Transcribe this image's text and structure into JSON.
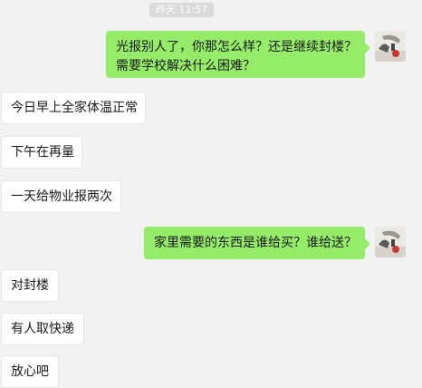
{
  "timestamp": "昨天 11:57",
  "messages": [
    {
      "side": "out",
      "lines": [
        "光报别人了，你那怎么样？还是继续封楼？",
        "需要学校解决什么困难？"
      ]
    },
    {
      "side": "in",
      "lines": [
        "今日早上全家体温正常"
      ]
    },
    {
      "side": "in",
      "lines": [
        "下午在再量"
      ]
    },
    {
      "side": "in",
      "lines": [
        "一天给物业报两次"
      ]
    },
    {
      "side": "out",
      "lines": [
        "家里需要的东西是谁给买？谁给送？"
      ]
    },
    {
      "side": "in",
      "lines": [
        "对封楼"
      ]
    },
    {
      "side": "in",
      "lines": [
        "有人取快递"
      ]
    },
    {
      "side": "in",
      "lines": [
        "放心吧"
      ]
    }
  ],
  "avatar_icon": "user-photo-avatar",
  "colors": {
    "background": "#f2f2f2",
    "outgoing_bubble": "#95ec69",
    "incoming_bubble": "#ffffff",
    "timestamp_pill": "#dadada"
  }
}
